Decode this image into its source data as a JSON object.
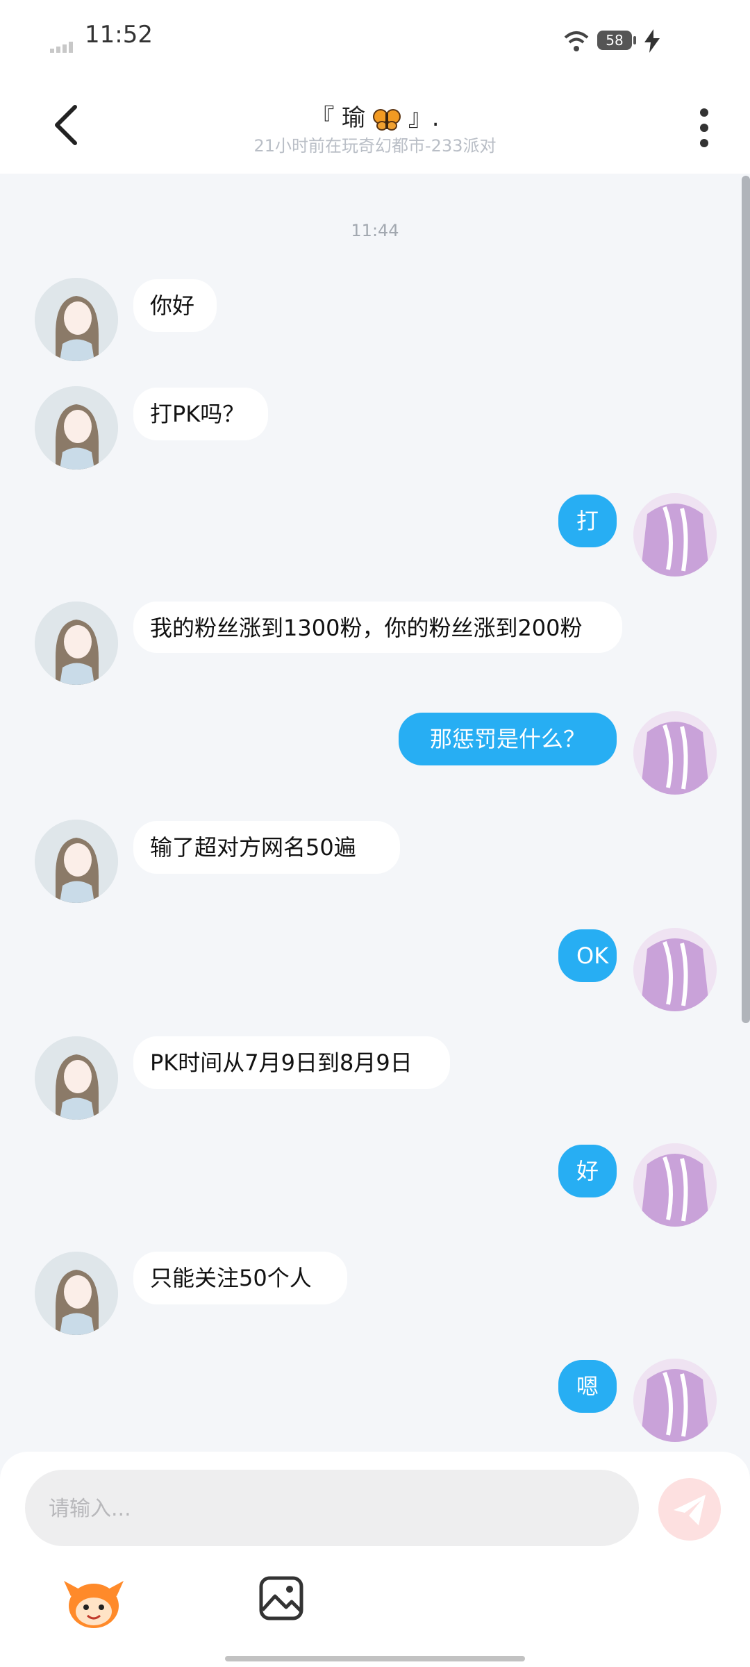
{
  "status_bar": {
    "time": "11:52",
    "battery": "58"
  },
  "header": {
    "title_prefix": "『 瑜",
    "title_suffix": "』.",
    "subtitle": "21小时前在玩奇幻都市-233派对"
  },
  "chat": {
    "timestamp": "11:44",
    "messages": [
      {
        "side": "in",
        "text": "你好"
      },
      {
        "side": "in",
        "text": "打PK吗？"
      },
      {
        "side": "out",
        "text": "打"
      },
      {
        "side": "in",
        "text": "我的粉丝涨到1300粉，你的粉丝涨到200粉"
      },
      {
        "side": "out",
        "text": "那惩罚是什么？"
      },
      {
        "side": "in",
        "text": "输了超对方网名50遍"
      },
      {
        "side": "out",
        "text": "OK"
      },
      {
        "side": "in",
        "text": "PK时间从7月9日到8月9日"
      },
      {
        "side": "out",
        "text": "好"
      },
      {
        "side": "in",
        "text": "只能关注50个人"
      },
      {
        "side": "out",
        "text": "嗯"
      }
    ]
  },
  "input": {
    "placeholder": "请输入..."
  },
  "icons": {
    "back": "back-arrow-icon",
    "more": "more-vertical-icon",
    "send": "paper-plane-icon",
    "emoji": "mascot-emoji-icon",
    "image": "image-icon"
  }
}
